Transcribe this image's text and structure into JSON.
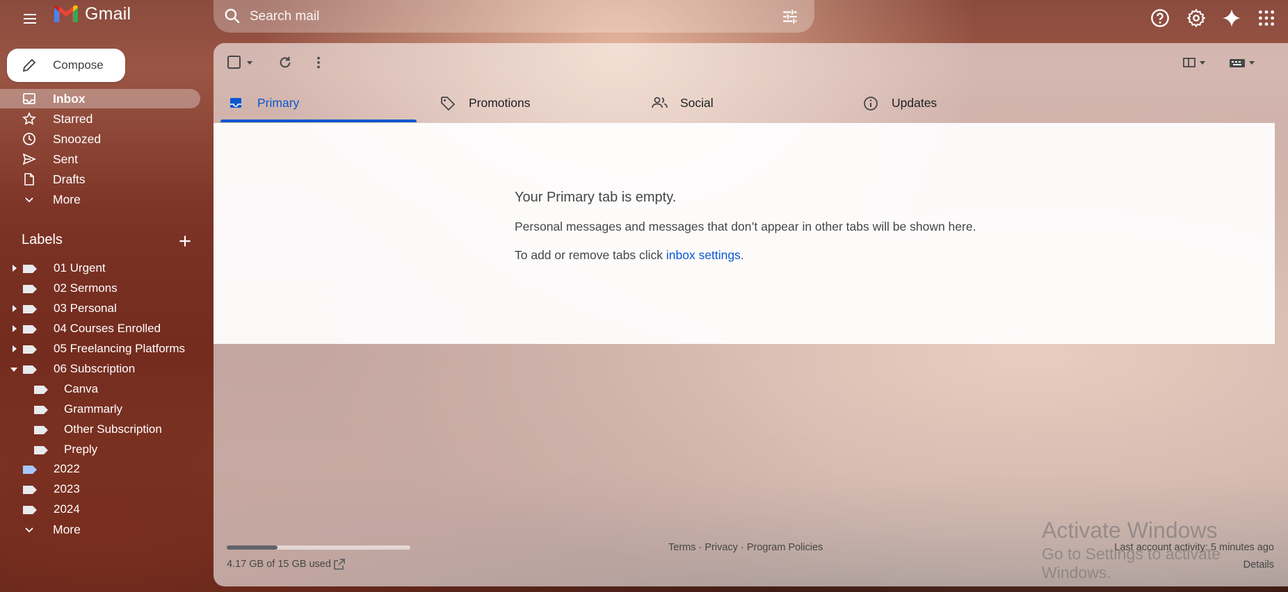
{
  "header": {
    "app_name": "Gmail",
    "search_placeholder": "Search mail"
  },
  "compose": {
    "label": "Compose"
  },
  "nav": [
    {
      "label": "Inbox",
      "icon": "inbox-icon",
      "active": true
    },
    {
      "label": "Starred",
      "icon": "star-icon"
    },
    {
      "label": "Snoozed",
      "icon": "clock-icon"
    },
    {
      "label": "Sent",
      "icon": "send-icon"
    },
    {
      "label": "Drafts",
      "icon": "draft-icon"
    },
    {
      "label": "More",
      "icon": "chevron-down-icon"
    }
  ],
  "labels": {
    "heading": "Labels",
    "items": [
      {
        "label": "01 Urgent"
      },
      {
        "label": "02 Sermons"
      },
      {
        "label": "03 Personal"
      },
      {
        "label": "04 Courses Enrolled"
      },
      {
        "label": "05 Freelancing Platforms"
      },
      {
        "label": "06 Subscription"
      },
      {
        "label": "Canva"
      },
      {
        "label": "Grammarly"
      },
      {
        "label": "Other Subscription"
      },
      {
        "label": "Preply"
      },
      {
        "label": "2022"
      },
      {
        "label": "2023"
      },
      {
        "label": "2024"
      }
    ],
    "more": "More"
  },
  "tabs": [
    {
      "label": "Primary",
      "icon": "inbox-icon",
      "active": true
    },
    {
      "label": "Promotions",
      "icon": "tag-icon"
    },
    {
      "label": "Social",
      "icon": "people-icon"
    },
    {
      "label": "Updates",
      "icon": "info-icon"
    }
  ],
  "empty_state": {
    "title": "Your Primary tab is empty.",
    "line1": "Personal messages and messages that don’t appear in other tabs will be shown here.",
    "line2_prefix": "To add or remove tabs click ",
    "line2_link": "inbox settings",
    "line2_suffix": "."
  },
  "footer": {
    "storage_text": "4.17 GB of 15 GB used",
    "storage_used_fraction": 0.278,
    "terms": "Terms",
    "privacy": "Privacy",
    "program_policies": "Program Policies",
    "separator": " · ",
    "last_activity": "Last account activity: 5 minutes ago",
    "details": "Details"
  },
  "watermark": {
    "line1": "Activate Windows",
    "line2": "Go to Settings to activate Windows."
  },
  "colors": {
    "accent": "#0b57d0",
    "label_2022": "#a8c7fa"
  }
}
